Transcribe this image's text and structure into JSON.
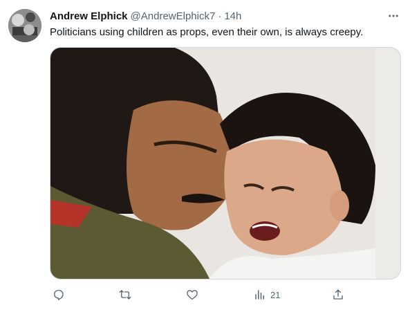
{
  "tweet": {
    "author_name": "Andrew Elphick",
    "author_handle": "@AndrewElphick7",
    "separator": "·",
    "time": "14h",
    "text": "Politicians using children as props, even their own, is always creepy.",
    "media_alt": "Photo of a man in military uniform kissing a crying young child"
  },
  "actions": {
    "reply_icon": "reply-icon",
    "retweet_icon": "retweet-icon",
    "like_icon": "like-icon",
    "views_icon": "views-icon",
    "views_count": "21",
    "share_icon": "share-icon"
  },
  "colors": {
    "text": "#0f1419",
    "secondary": "#536471",
    "border": "#cfd9de"
  }
}
